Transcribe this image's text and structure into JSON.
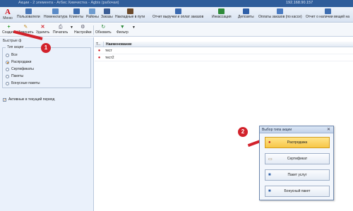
{
  "window": {
    "title": "Акции - 2 элемента - Агбис Химчистка - Agbis (рабочая)",
    "ip": "192.168.90.157"
  },
  "ribbon": {
    "menu_label": "Меню",
    "logo": "A",
    "items": [
      {
        "label": "Пользователи",
        "color": "#4a78b8"
      },
      {
        "label": "Номенклатура",
        "color": "#5a8bc8"
      },
      {
        "label": "Клиенты",
        "color": "#3d6db0"
      },
      {
        "label": "Районы",
        "color": "#6e9ccf"
      },
      {
        "label": "Заказы",
        "color": "#3c5e96"
      },
      {
        "label": "Накладные в пути",
        "color": "#6b4a2b"
      },
      {
        "label": "Отчет выручки и оплат заказов",
        "color": "#3a6ab0"
      },
      {
        "label": "Инкассация",
        "color": "#2e8b3a"
      },
      {
        "label": "Депозиты",
        "color": "#2f60a8"
      },
      {
        "label": "Оплаты заказов (по кассе)",
        "color": "#4a7bc2"
      },
      {
        "label": "Отчет о наличии вещей на",
        "color": "#3d6db0"
      }
    ]
  },
  "toolbar": {
    "items": [
      {
        "label": "Создать",
        "icon": "+"
      },
      {
        "label": "Изменить",
        "icon": "✎"
      },
      {
        "label": "Удалить",
        "icon": "✕"
      },
      {
        "label": "Печатать",
        "icon": "⎙"
      },
      {
        "label": "Настройки",
        "icon": "⚙"
      },
      {
        "label": "Обновить",
        "icon": "↻"
      },
      {
        "label": "Фильтр",
        "icon": "▼"
      }
    ]
  },
  "left_panel": {
    "header": "Быстрые ф",
    "group_title": "Тип акции",
    "options": [
      "Все",
      "Распродажи",
      "Сертификаты",
      "Пакеты",
      "Бонусные пакеты"
    ],
    "selected": 1,
    "active_checkbox": "Активные в текущий период"
  },
  "grid": {
    "col_type": "Т...",
    "col_name": "Наименование",
    "rows": [
      "тест",
      "тест2"
    ]
  },
  "callouts": [
    "1",
    "2"
  ],
  "dialog": {
    "title": "Выбор типа акции",
    "close": "✕",
    "buttons": [
      {
        "label": "Распродажа",
        "icon": "🏷"
      },
      {
        "label": "Сертификат",
        "icon": "✉"
      },
      {
        "label": "Пакет услуг",
        "icon": "▣"
      },
      {
        "label": "Бонусный пакет",
        "icon": "▤"
      }
    ],
    "selected_index": 0
  },
  "colors": {
    "titlebar": "#2f5d9a",
    "accent_red": "#d2222b",
    "selected_yellow": "#f7c748"
  }
}
